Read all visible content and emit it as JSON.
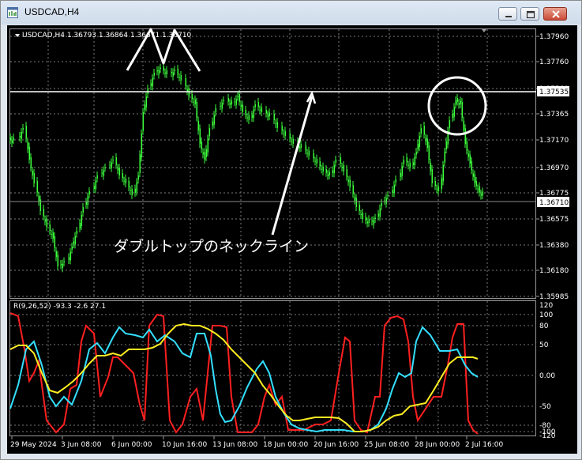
{
  "window": {
    "title": "USDCAD,H4"
  },
  "main_chart": {
    "header": "USDCAD,H4  1.36793 1.36864 1.36671 1.36710",
    "price_ticks": [
      "1.37960",
      "1.37760",
      "1.37560",
      "1.37365",
      "1.37170",
      "1.36970",
      "1.36775",
      "1.36575",
      "1.36380",
      "1.36180",
      "1.35985"
    ],
    "current_price": "1.36710",
    "line_price": "1.37535",
    "annotation_text": "ダブルトップのネックライン",
    "colors": {
      "candle": "#3cff3c",
      "neckline": "#ffffff",
      "background": "#000000",
      "grid": "#7a7a7a"
    }
  },
  "indicator": {
    "header": "R(9,26,52) -93.3 -2.6 27.1",
    "ticks": [
      "120",
      "100",
      "80",
      "50",
      "0.00",
      "-50",
      "-80",
      "-100",
      "-120"
    ],
    "colors": {
      "fast": "#ff2020",
      "mid": "#33e0ff",
      "slow": "#ffee22"
    }
  },
  "time_axis": [
    "29 May 2024",
    "3 Jun 08:00",
    "6 Jun 00:00",
    "10 Jun 16:00",
    "13 Jun 08:00",
    "18 Jun 00:00",
    "20 Jun 16:00",
    "25 Jun 08:00",
    "28 Jun 00:00",
    "2 Jul 16:00"
  ]
}
